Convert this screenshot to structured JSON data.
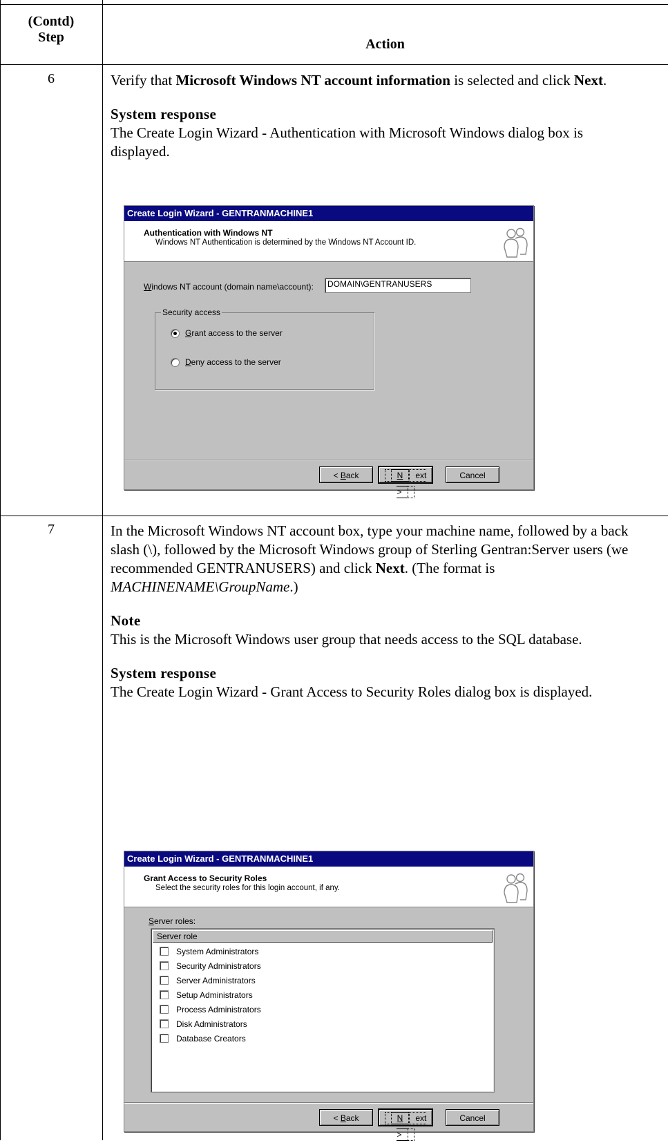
{
  "table": {
    "header_step": "(Contd)\nStep",
    "header_step_line1": "(Contd)",
    "header_step_line2": "Step",
    "header_action": "Action"
  },
  "rows": [
    {
      "step": "6",
      "instruction_pre": "Verify that ",
      "instruction_bold": "Microsoft Windows NT account information",
      "instruction_mid": " is selected and click ",
      "instruction_next": "Next",
      "instruction_end": ".",
      "response_head": "System response",
      "response_text": "The Create Login Wizard - Authentication with Microsoft Windows dialog box is displayed."
    },
    {
      "step": "7",
      "instruction_pre": "In the Microsoft Windows NT account box, type your machine name, followed by a back slash (\\), followed by the Microsoft Windows group of Sterling Gentran:Server users (we recommended GENTRANUSERS) and click ",
      "instruction_next": "Next",
      "instruction_mid": ". (The format is ",
      "instruction_italic": "MACHINENAME\\GroupName",
      "instruction_end": ".)",
      "note_head": "Note",
      "note_text": "This is the Microsoft Windows user group that needs access to the SQL database.",
      "response_head": "System response",
      "response_text": "The Create Login Wizard - Grant Access to Security Roles dialog box is displayed."
    }
  ],
  "dialog1": {
    "title": "Create Login Wizard - GENTRANMACHINE1",
    "heading": "Authentication with Windows NT",
    "subheading": "Windows NT Authentication is determined by the Windows NT Account ID.",
    "account_label_u": "W",
    "account_label_rest": "indows NT account (domain name\\account):",
    "account_value": "DOMAIN\\GENTRANUSERS",
    "group_label": "Security access",
    "radio_grant_u": "G",
    "radio_grant_rest": "rant access to the server",
    "radio_deny_u": "D",
    "radio_deny_rest": "eny access to the server",
    "back_pre": "< ",
    "back_u": "B",
    "back_rest": "ack",
    "next_u": "N",
    "next_rest": "ext >",
    "cancel": "Cancel"
  },
  "dialog2": {
    "title": "Create Login Wizard - GENTRANMACHINE1",
    "heading": "Grant Access to Security Roles",
    "subheading": "Select the security roles for this login account, if any.",
    "roles_label_u": "S",
    "roles_label_rest": "erver roles:",
    "column_header": "Server role",
    "roles": [
      "System Administrators",
      "Security Administrators",
      "Server Administrators",
      "Setup Administrators",
      "Process Administrators",
      "Disk Administrators",
      "Database Creators"
    ],
    "back_pre": "< ",
    "back_u": "B",
    "back_rest": "ack",
    "next_u": "N",
    "next_rest": "ext >",
    "cancel": "Cancel"
  },
  "icon_names": [
    "wizard-people-icon",
    "checkbox-icon",
    "radio-icon"
  ]
}
